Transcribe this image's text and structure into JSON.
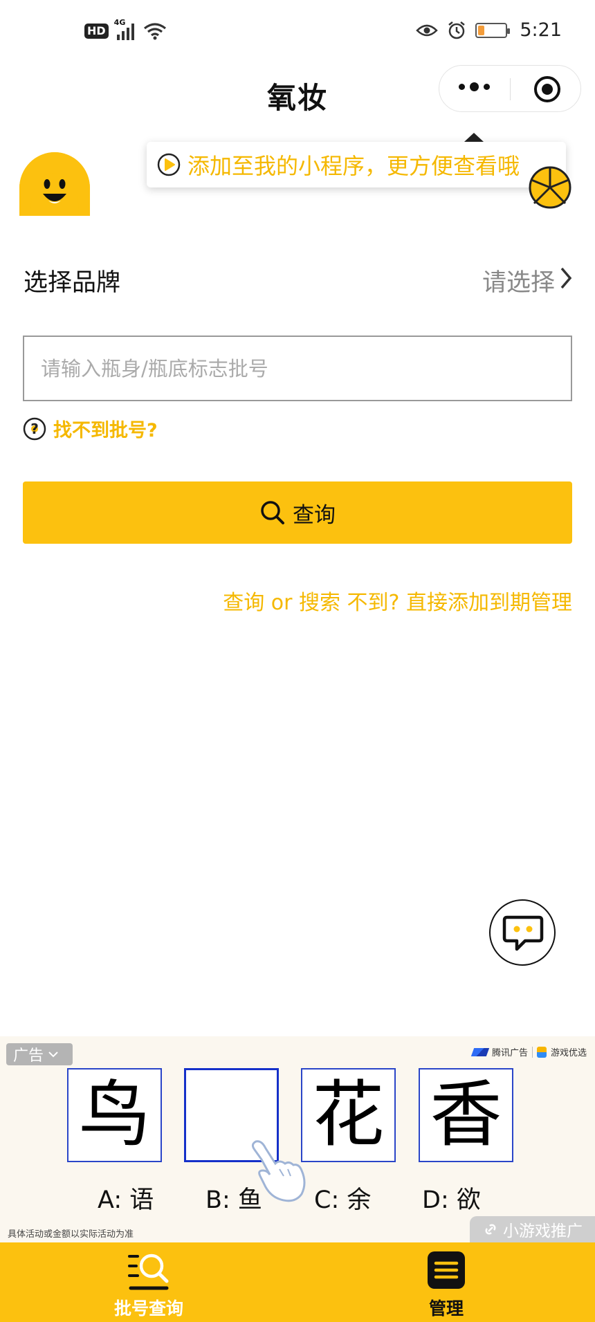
{
  "status_bar": {
    "hd": "HD",
    "network": "4G",
    "time": "5:21",
    "battery_level": 0.2
  },
  "header": {
    "title": "氧妆"
  },
  "tooltip": {
    "text": "添加至我的小程序，更方便查看哦"
  },
  "brand": {
    "label": "选择品牌",
    "value": "请选择"
  },
  "batch": {
    "placeholder": "请输入瓶身/瓶底标志批号"
  },
  "help": {
    "text": "找不到批号?"
  },
  "search_button": {
    "label": "查询"
  },
  "add_link": {
    "text": "查询 or 搜索 不到? 直接添加到期管理"
  },
  "ad": {
    "tag": "广告",
    "provider": "腾讯广告",
    "partner": "游戏优选",
    "chars": [
      "鸟",
      "",
      "花",
      "香"
    ],
    "options": [
      "A: 语",
      "B: 鱼",
      "C: 余",
      "D: 欲"
    ],
    "note": "具体活动或金额以实际活动为准",
    "badge": "小游戏推广"
  },
  "tabbar": {
    "tabs": [
      {
        "label": "批号查询"
      },
      {
        "label": "管理"
      }
    ]
  },
  "colors": {
    "accent": "#fcc10f",
    "link": "#f5b800",
    "ad_border": "#2a45c8"
  }
}
